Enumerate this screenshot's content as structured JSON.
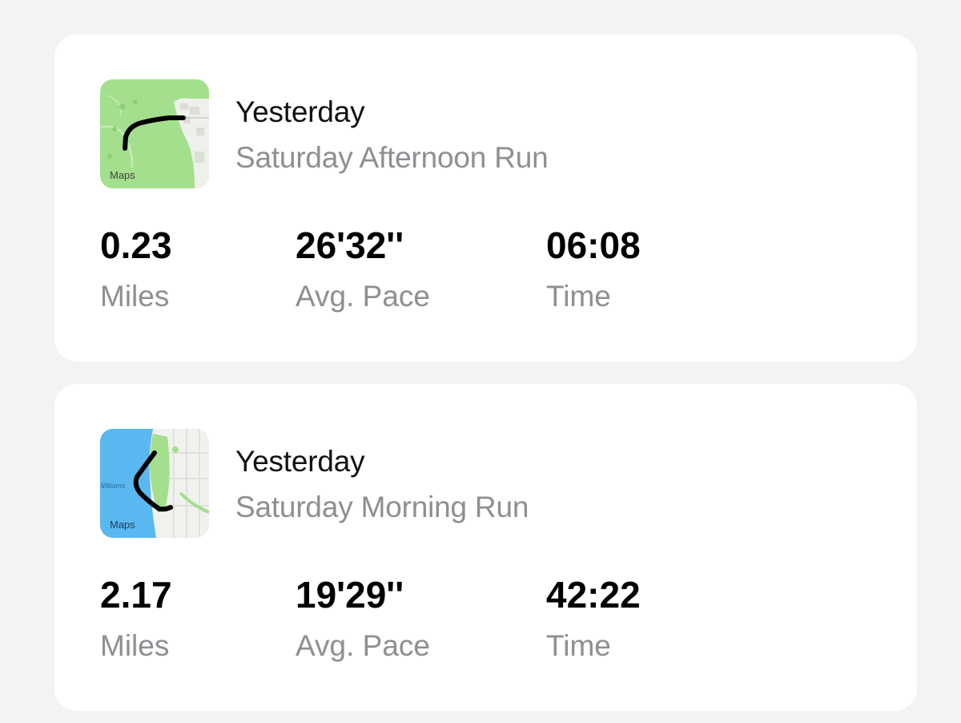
{
  "colors": {
    "background": "#f2f3f5",
    "card": "#ffffff",
    "primary_text": "#111111",
    "secondary_text": "#8e8e93",
    "map_park_green": "#9fdf87",
    "map_water_blue": "#5ab8f0",
    "route_line": "#000000"
  },
  "activities": [
    {
      "when": "Yesterday",
      "name": "Saturday Afternoon Run",
      "map": {
        "icon": "map-thumbnail",
        "badge": "Maps"
      },
      "stats": [
        {
          "value": "0.23",
          "label": "Miles"
        },
        {
          "value": "26'32''",
          "label": "Avg. Pace"
        },
        {
          "value": "06:08",
          "label": "Time"
        }
      ]
    },
    {
      "when": "Yesterday",
      "name": "Saturday Morning Run",
      "map": {
        "icon": "map-thumbnail",
        "badge": "Maps",
        "street_label": "Williams"
      },
      "stats": [
        {
          "value": "2.17",
          "label": "Miles"
        },
        {
          "value": "19'29''",
          "label": "Avg. Pace"
        },
        {
          "value": "42:22",
          "label": "Time"
        }
      ]
    }
  ]
}
